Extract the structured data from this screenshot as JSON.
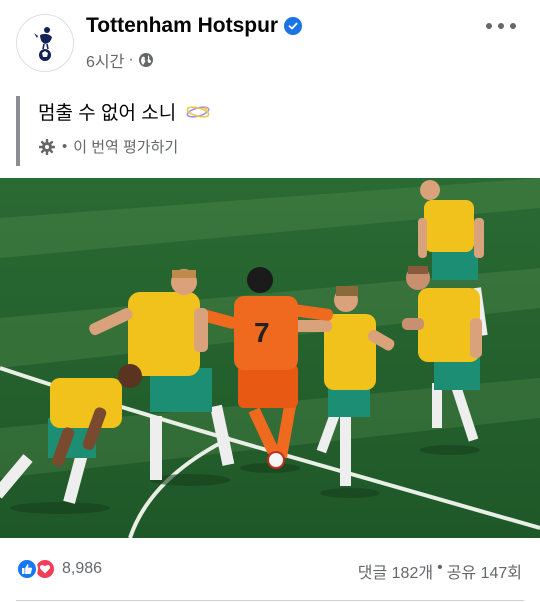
{
  "post": {
    "author": "Tottenham Hotspur",
    "time": "6시간",
    "separator": "·",
    "caption": "멈출 수 없어 소니",
    "translation_note_separator": "•",
    "translation_rate": "이 번역 평가하기"
  },
  "icons": {
    "avatar": "tottenham-crest-icon",
    "verified": "verified-badge-icon",
    "privacy": "globe-icon",
    "more": "more-options-icon",
    "caption_emoji": "dizzy-emoji-icon",
    "translate_settings": "gear-icon",
    "like_reaction": "like-reaction-icon",
    "love_reaction": "love-reaction-icon"
  },
  "footer": {
    "reaction_count": "8,986",
    "comments": "댓글 182개",
    "stats_separator": "•",
    "shares": "공유 147회"
  },
  "colors": {
    "verified": "#1b74e4",
    "like": "#1877f2",
    "love": "#f33e58",
    "pitch": "#2f6b34",
    "australia_kit": "#f1c21b",
    "korea_kit": "#ef6a1e"
  }
}
